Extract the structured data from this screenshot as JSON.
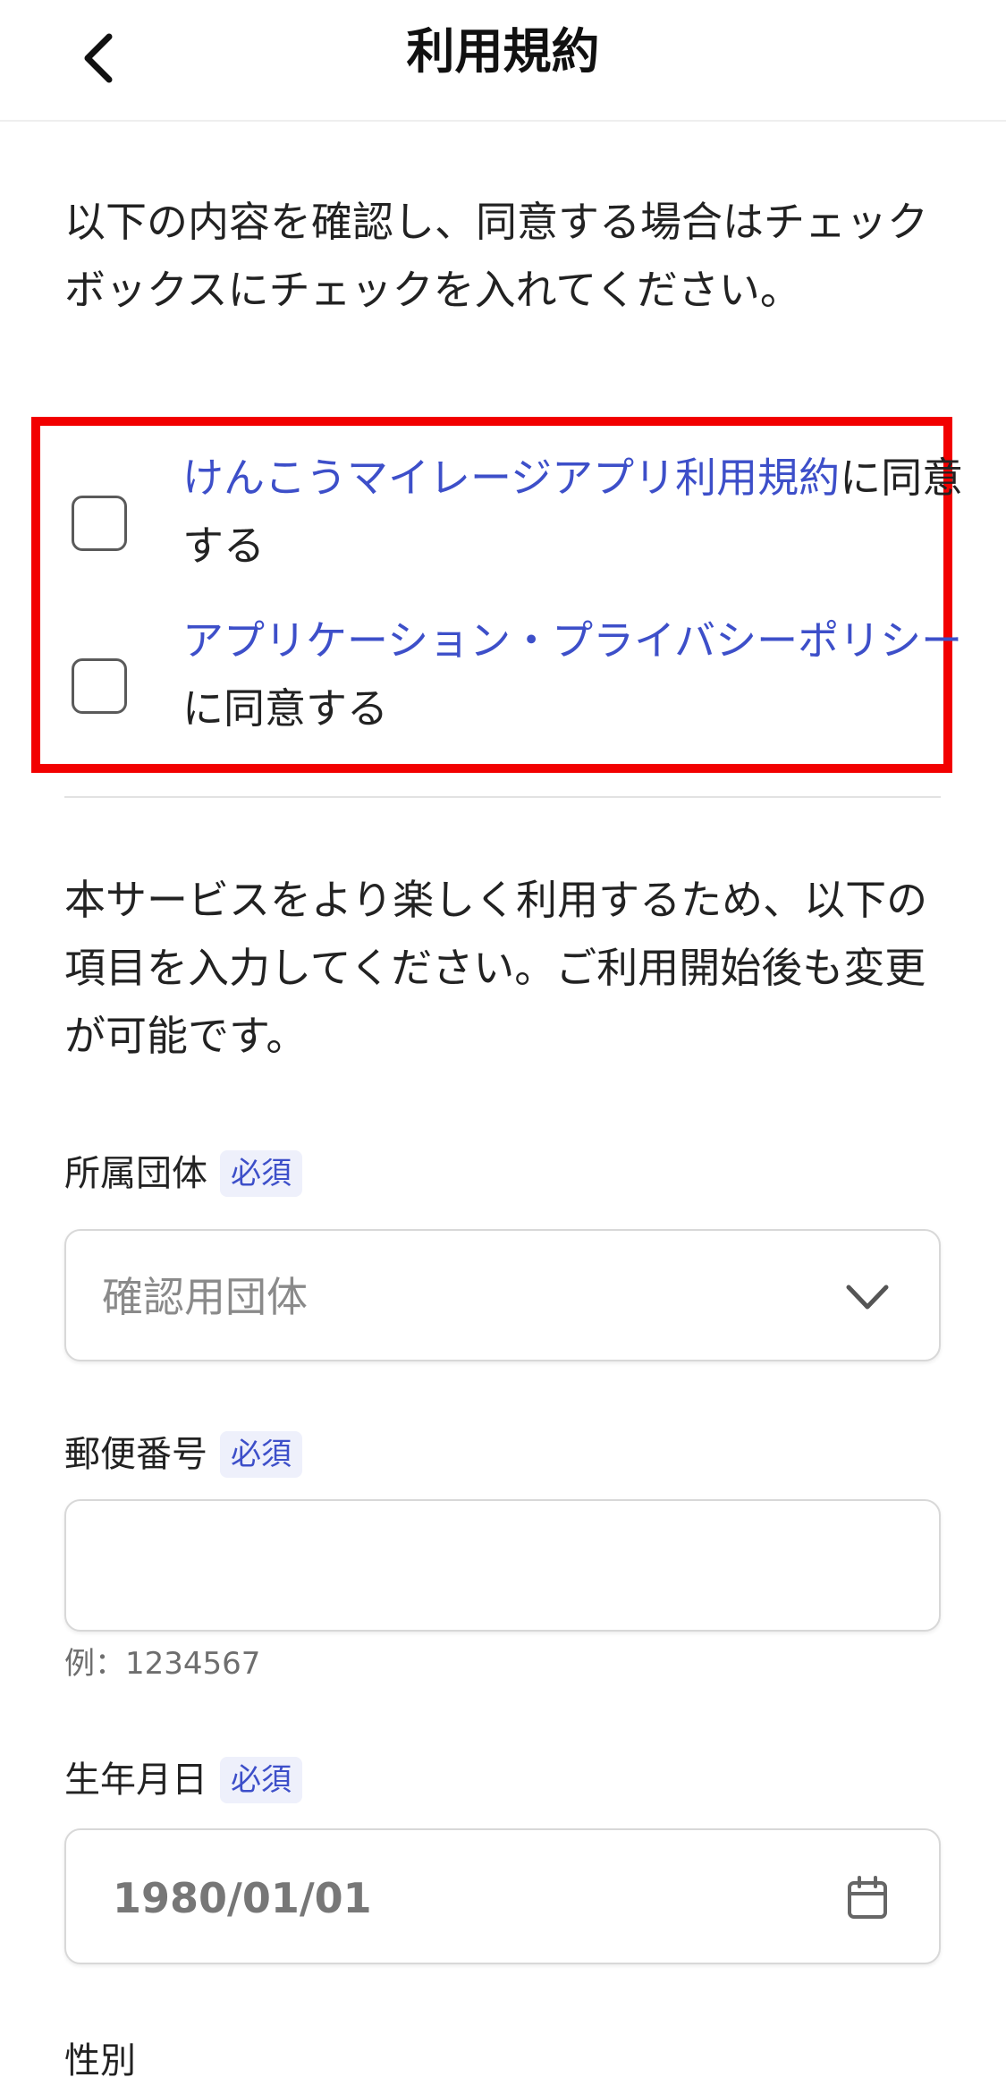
{
  "header": {
    "title": "利用規約",
    "back_icon": "chevron-left-icon"
  },
  "intro": {
    "text": "以下の内容を確認し、同意する場合はチェックボックスにチェックを入れてください。"
  },
  "agreements": [
    {
      "checked": false,
      "link_text": "けんこうマイレージアプリ利用規約",
      "suffix": "に同意する"
    },
    {
      "checked": false,
      "link_text": "アプリケーション・プライバシーポリシー",
      "suffix": "に同意する"
    }
  ],
  "service_intro": {
    "text": "本サービスをより楽しく利用するため、以下の項目を入力してください。ご利用開始後も変更が可能です。"
  },
  "fields": {
    "organization": {
      "label": "所属団体",
      "required": "必須",
      "value": "確認用団体",
      "icon": "chevron-down-icon"
    },
    "postal_code": {
      "label": "郵便番号",
      "required": "必須",
      "value": "",
      "hint": "例：1234567"
    },
    "birth_date": {
      "label": "生年月日",
      "required": "必須",
      "value": "1980/01/01",
      "icon": "calendar-icon"
    },
    "gender": {
      "label": "性別"
    }
  },
  "colors": {
    "link": "#3d4fc9",
    "highlight_border": "#f20000",
    "badge_bg": "#eef0fb"
  }
}
